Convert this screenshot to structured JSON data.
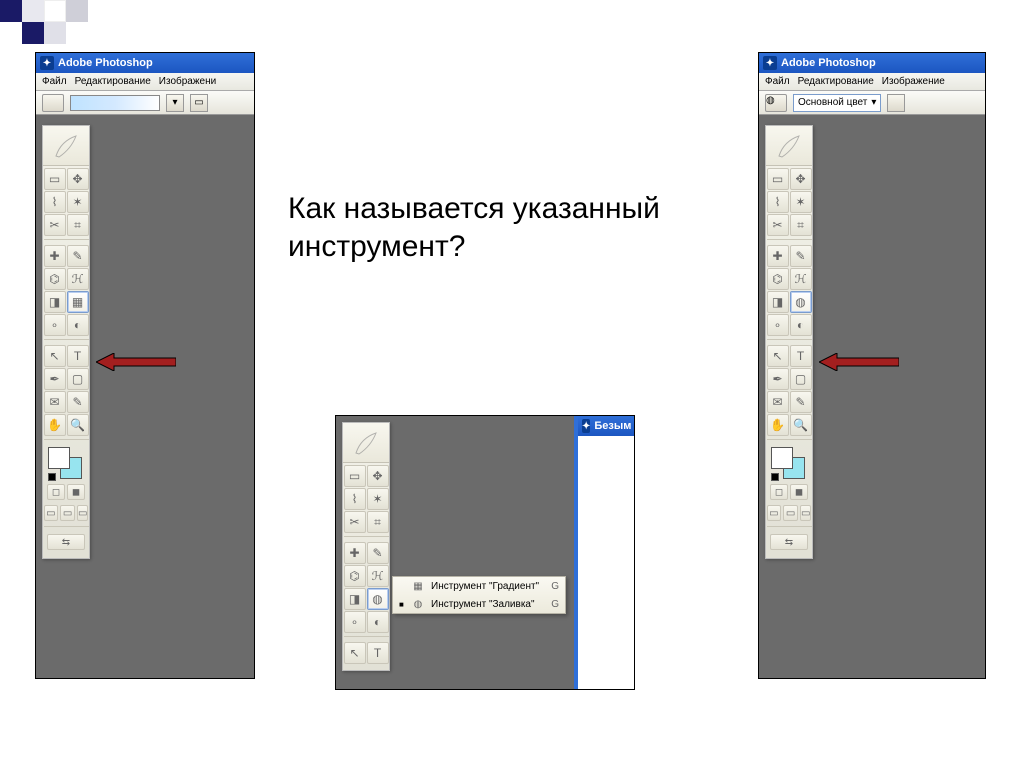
{
  "question_line1": "Как называется указанный",
  "question_line2": "инструмент?",
  "app_title": "Adobe Photoshop",
  "menus": {
    "file": "Файл",
    "edit": "Редактирование",
    "image_short": "Изображени",
    "image": "Изображение"
  },
  "options_bar": {
    "fill_label": "Основной цвет"
  },
  "doc_title": "Безым",
  "flyout": {
    "gradient": {
      "label": "Инструмент \"Градиент\"",
      "key": "G"
    },
    "bucket": {
      "label": "Инструмент \"Заливка\"",
      "key": "G"
    }
  },
  "tool_icons": {
    "marquee": "▭",
    "move": "✥",
    "lasso": "⌇",
    "wand": "✶",
    "crop": "✂",
    "slice": "⌗",
    "heal": "✚",
    "brush": "✎",
    "stamp": "⌬",
    "history": "ℋ",
    "eraser": "◨",
    "gradient": "▦",
    "bucket": "◍",
    "blur": "∘",
    "dodge": "◐",
    "path": "↖",
    "type": "T",
    "pen": "✒",
    "shape": "▢",
    "notes": "✉",
    "eyedrop": "✎",
    "hand": "✋",
    "zoom": "🔍",
    "jump": "⇆"
  }
}
